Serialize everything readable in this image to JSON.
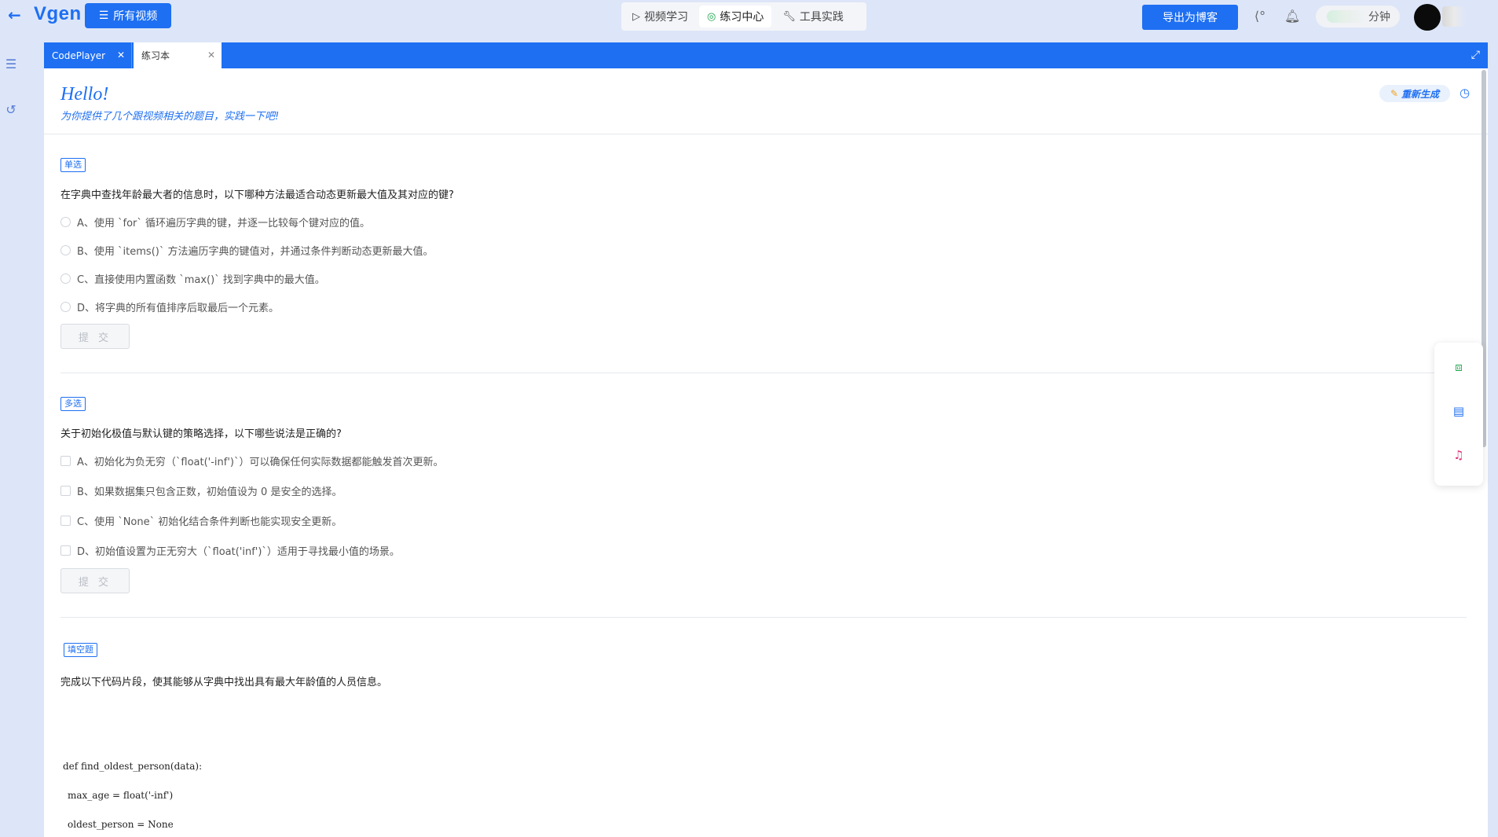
{
  "topbar": {
    "logo": "Vgen",
    "all_videos_label": "所有视频",
    "nav_tabs": [
      {
        "label": "视频学习",
        "icon": "play-icon",
        "active": false
      },
      {
        "label": "练习中心",
        "icon": "target-icon",
        "active": true
      },
      {
        "label": "工具实践",
        "icon": "wrench-icon",
        "active": false
      }
    ],
    "export_label": "导出为博客",
    "timer_unit": "分钟"
  },
  "tabs": [
    {
      "label": "CodePlayer",
      "active": false
    },
    {
      "label": "练习本",
      "active": true
    }
  ],
  "header": {
    "greeting": "Hello!",
    "subtitle": "为你提供了几个跟视频相关的题目，实践一下吧!",
    "regen_label": "重新生成"
  },
  "q1": {
    "type_label": "单选",
    "text": "在字典中查找年龄最大者的信息时，以下哪种方法最适合动态更新最大值及其对应的键?",
    "options": [
      "A、使用 `for` 循环遍历字典的键，并逐一比较每个键对应的值。",
      "B、使用 `items()` 方法遍历字典的键值对，并通过条件判断动态更新最大值。",
      "C、直接使用内置函数 `max()` 找到字典中的最大值。",
      "D、将字典的所有值排序后取最后一个元素。"
    ],
    "submit_label": "提 交"
  },
  "q2": {
    "type_label": "多选",
    "text": "关于初始化极值与默认键的策略选择，以下哪些说法是正确的?",
    "options": [
      "A、初始化为负无穷（`float('-inf')`）可以确保任何实际数据都能触发首次更新。",
      "B、如果数据集只包含正数，初始值设为 0 是安全的选择。",
      "C、使用 `None` 初始化结合条件判断也能实现安全更新。",
      "D、初始值设置为正无穷大（`float('inf')`）适用于寻找最小值的场景。"
    ],
    "submit_label": "提 交"
  },
  "q3": {
    "type_label": "填空题",
    "text": "完成以下代码片段，使其能够从字典中找出具有最大年龄值的人员信息。",
    "code": [
      "def find_oldest_person(data):",
      "max_age = float('-inf')",
      "oldest_person = None"
    ]
  },
  "colors": {
    "accent": "#1e6ff2",
    "page_bg": "#dde6f8"
  }
}
